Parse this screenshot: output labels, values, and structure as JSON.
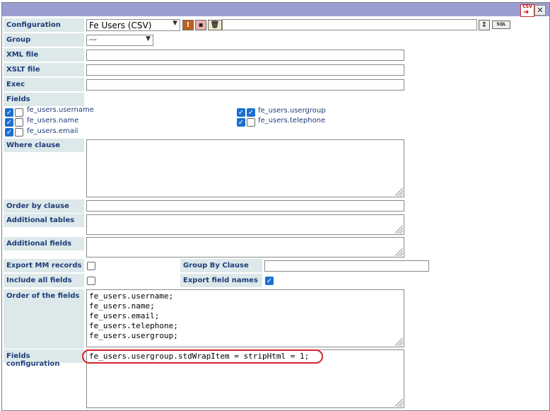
{
  "labels": {
    "configuration": "Configuration",
    "group": "Group",
    "xml_file": "XML file",
    "xslt_file": "XSLT file",
    "exec": "Exec",
    "fields": "Fields",
    "where_clause": "Where clause",
    "order_by_clause": "Order by clause",
    "additional_tables": "Additional tables",
    "additional_fields": "Additional fields",
    "export_mm_records": "Export MM records",
    "group_by_clause": "Group By Clause",
    "include_all_fields": "Include all fields",
    "export_field_names": "Export field names",
    "order_of_fields": "Order of the fields",
    "fields_configuration": "Fields configuration"
  },
  "toolbar": {
    "csv_icon_text": "CSV",
    "close_glyph": "✕"
  },
  "configuration": {
    "selected": "Fe Users (CSV)",
    "name_value": "",
    "sql_button": "SQL"
  },
  "group": {
    "selected": "---"
  },
  "fields": {
    "left": [
      {
        "name": "fe_users.username",
        "checked": true,
        "second_checked": false
      },
      {
        "name": "fe_users.name",
        "checked": true,
        "second_checked": false
      },
      {
        "name": "fe_users.email",
        "checked": true,
        "second_checked": false
      }
    ],
    "right": [
      {
        "name": "fe_users.usergroup",
        "checked": true,
        "second_checked": true
      },
      {
        "name": "fe_users.telephone",
        "checked": true,
        "second_checked": false
      }
    ]
  },
  "checkboxes": {
    "export_mm_records": false,
    "include_all_fields": false,
    "export_field_names": true
  },
  "order_of_fields": "fe_users.username;\nfe_users.name;\nfe_users.email;\nfe_users.telephone;\nfe_users.usergroup;",
  "fields_configuration": "fe_users.usergroup.stdWrapItem = stripHtml = 1;",
  "colors": {
    "titlebar": "#9a9ed0",
    "label_bg": "#dce8ea",
    "label_text": "#1f3c78",
    "highlight": "#d4252b",
    "checkbox": "#1a6fd0"
  }
}
